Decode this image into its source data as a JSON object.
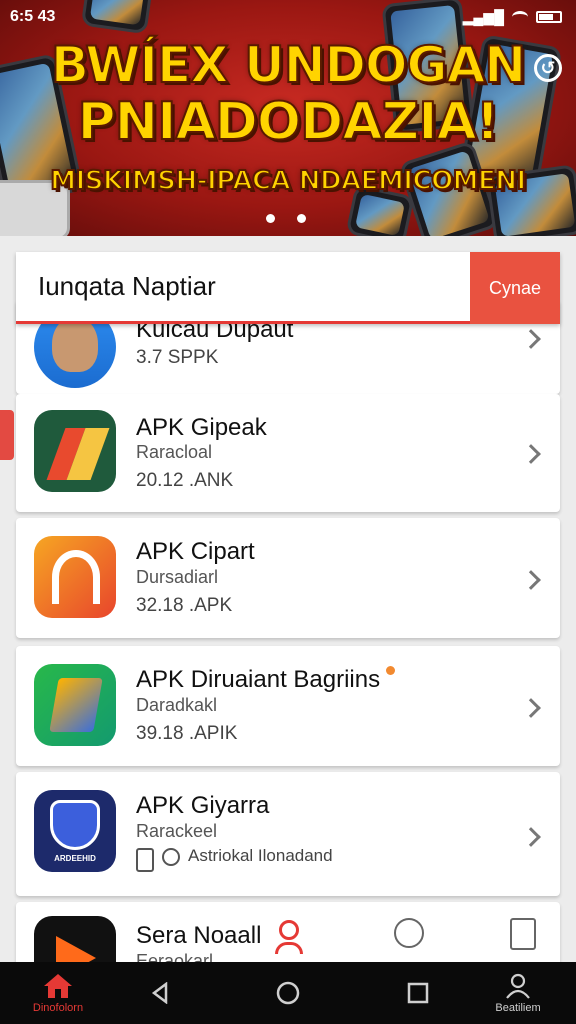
{
  "status_bar": {
    "time": "6:5 43"
  },
  "banner": {
    "title_line1": "BWÍEX UNDOGAN",
    "title_line2": "PNIADODAZIA!",
    "subtitle": "MISKIMSH-IPACA NDAEMICOMENI",
    "carousel_dots": 2
  },
  "search": {
    "value": "Iunqata Naptiar",
    "button_label": "Cynae"
  },
  "apps": [
    {
      "name": "Kulcau Dupaut",
      "sub": "",
      "size": "3.7 SPPK"
    },
    {
      "name": "APK Gipeak",
      "sub": "Raracloal",
      "size": "20.12 .ANK"
    },
    {
      "name": "APK Cipart",
      "sub": "Dursadiarl",
      "size": "32.18 .APK"
    },
    {
      "name": "APK Diruaiant Bagriins",
      "sub": "Daradkakl",
      "size": "39.18 .APIK"
    },
    {
      "name": "APK Giyarra",
      "sub": "Rarackeel",
      "size": "Astriokal Ilonadand",
      "icon_text": "ARDEEHID"
    },
    {
      "name": "Sera Noaall",
      "sub": "Eeraokarl",
      "size": ""
    }
  ],
  "nav": {
    "home_label": "Dinofolorn",
    "profile_label": "Beatiliem"
  },
  "colors": {
    "accent": "#e53935",
    "banner_red": "#b01e18",
    "title_yellow": "#ffd400"
  }
}
